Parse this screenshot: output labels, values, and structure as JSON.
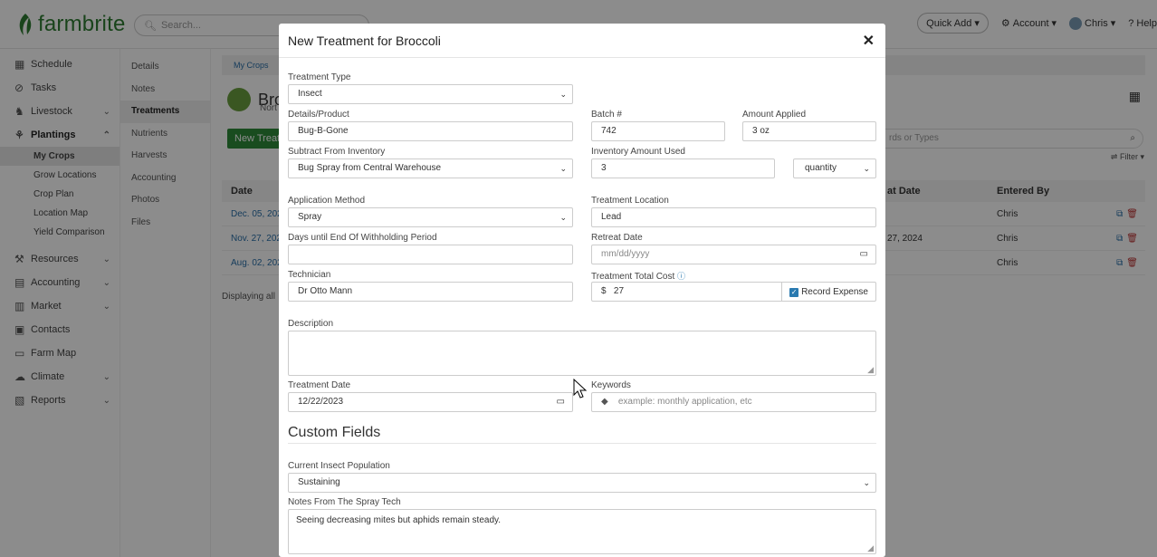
{
  "app": {
    "logo_text": "farmbrite",
    "search_placeholder": "Search..."
  },
  "topbar": {
    "quick_add": "Quick Add",
    "account": "Account",
    "user": "Chris",
    "help": "Help"
  },
  "sidebar": {
    "items": [
      {
        "label": "Schedule",
        "icon": "calendar-icon"
      },
      {
        "label": "Tasks",
        "icon": "check-circle-icon"
      },
      {
        "label": "Livestock",
        "icon": "cow-icon"
      },
      {
        "label": "Plantings",
        "icon": "sprout-icon"
      },
      {
        "label": "Resources",
        "icon": "tools-icon"
      },
      {
        "label": "Accounting",
        "icon": "calculator-icon"
      },
      {
        "label": "Market",
        "icon": "store-icon"
      },
      {
        "label": "Contacts",
        "icon": "contact-card-icon"
      },
      {
        "label": "Farm Map",
        "icon": "map-icon"
      },
      {
        "label": "Climate",
        "icon": "cloud-icon"
      },
      {
        "label": "Reports",
        "icon": "report-icon"
      }
    ],
    "plantings_sub": [
      "My Crops",
      "Grow Locations",
      "Crop Plan",
      "Location Map",
      "Yield Comparison"
    ]
  },
  "subsidebar": [
    "Details",
    "Notes",
    "Treatments",
    "Nutrients",
    "Harvests",
    "Accounting",
    "Photos",
    "Files"
  ],
  "main": {
    "breadcrumb": "My Crops",
    "crop_name": "Bro",
    "crop_sub": "Nort",
    "new_button": "New Treatm",
    "search_placeholder": "rds or Types",
    "filter": "Filter",
    "columns": {
      "date": "Date",
      "retreat": "at Date",
      "entered_by": "Entered By"
    },
    "rows": [
      {
        "date": "Dec. 05, 202",
        "retreat": "",
        "by": "Chris"
      },
      {
        "date": "Nov. 27, 202",
        "retreat": "27, 2024",
        "by": "Chris"
      },
      {
        "date": "Aug. 02, 202",
        "retreat": "",
        "by": "Chris"
      }
    ],
    "displaying": "Displaying all"
  },
  "modal": {
    "title": "New Treatment for Broccoli",
    "treatment_type": {
      "label": "Treatment Type",
      "value": "Insect"
    },
    "details_product": {
      "label": "Details/Product",
      "value": "Bug-B-Gone"
    },
    "batch": {
      "label": "Batch #",
      "value": "742"
    },
    "amount_applied": {
      "label": "Amount Applied",
      "value": "3 oz"
    },
    "subtract_inventory": {
      "label": "Subtract From Inventory",
      "value": "Bug Spray from Central Warehouse"
    },
    "inventory_amount": {
      "label": "Inventory Amount Used",
      "value": "3",
      "unit": "quantity"
    },
    "application_method": {
      "label": "Application Method",
      "value": "Spray"
    },
    "treatment_location": {
      "label": "Treatment Location",
      "value": "Lead"
    },
    "withholding_days": {
      "label": "Days until End Of Withholding Period",
      "value": ""
    },
    "retreat_date": {
      "label": "Retreat Date",
      "placeholder": "mm/dd/yyyy"
    },
    "technician": {
      "label": "Technician",
      "value": "Dr Otto Mann"
    },
    "total_cost": {
      "label": "Treatment Total Cost",
      "currency": "$",
      "value": "27",
      "record_expense": "Record Expense"
    },
    "description": {
      "label": "Description",
      "value": ""
    },
    "treatment_date": {
      "label": "Treatment Date",
      "value": "12/22/2023"
    },
    "keywords": {
      "label": "Keywords",
      "placeholder": "example: monthly application, etc"
    },
    "custom_fields_title": "Custom Fields",
    "insect_population": {
      "label": "Current Insect Population",
      "value": "Sustaining"
    },
    "spray_notes": {
      "label": "Notes From The Spray Tech",
      "value": "Seeing decreasing mites but aphids remain steady."
    }
  }
}
